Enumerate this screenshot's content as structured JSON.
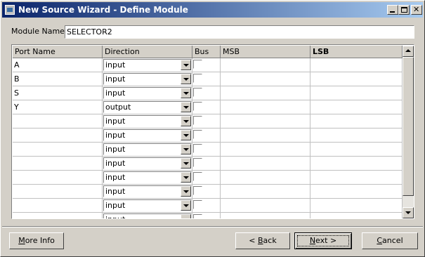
{
  "window": {
    "title": "New Source Wizard - Define Module"
  },
  "module": {
    "label": "Module Name",
    "value": "SELECTOR2"
  },
  "grid": {
    "columns": [
      "Port Name",
      "Direction",
      "Bus",
      "MSB",
      "LSB"
    ],
    "rows": [
      {
        "port": "A",
        "direction": "input"
      },
      {
        "port": "B",
        "direction": "input"
      },
      {
        "port": "S",
        "direction": "input"
      },
      {
        "port": "Y",
        "direction": "output"
      },
      {
        "port": "",
        "direction": "input"
      },
      {
        "port": "",
        "direction": "input"
      },
      {
        "port": "",
        "direction": "input"
      },
      {
        "port": "",
        "direction": "input"
      },
      {
        "port": "",
        "direction": "input"
      },
      {
        "port": "",
        "direction": "input"
      },
      {
        "port": "",
        "direction": "input"
      },
      {
        "port": "",
        "direction": "input"
      }
    ]
  },
  "buttons": {
    "more_info": {
      "mnemonic": "M",
      "rest": "ore Info"
    },
    "back": {
      "prefix": "< ",
      "mnemonic": "B",
      "rest": "ack"
    },
    "next": {
      "mnemonic": "N",
      "rest": "ext >"
    },
    "cancel": {
      "mnemonic": "C",
      "rest": "ancel"
    }
  },
  "icons": {
    "app": "app-icon",
    "minimize": "minimize-icon",
    "maximize": "maximize-icon",
    "close": "close-icon",
    "dropdown": "chevron-down-icon",
    "scroll_up": "arrow-up-icon",
    "scroll_down": "arrow-down-icon"
  },
  "colors": {
    "title_start": "#0a246a",
    "title_end": "#a6caf0",
    "face": "#d4d0c8"
  }
}
